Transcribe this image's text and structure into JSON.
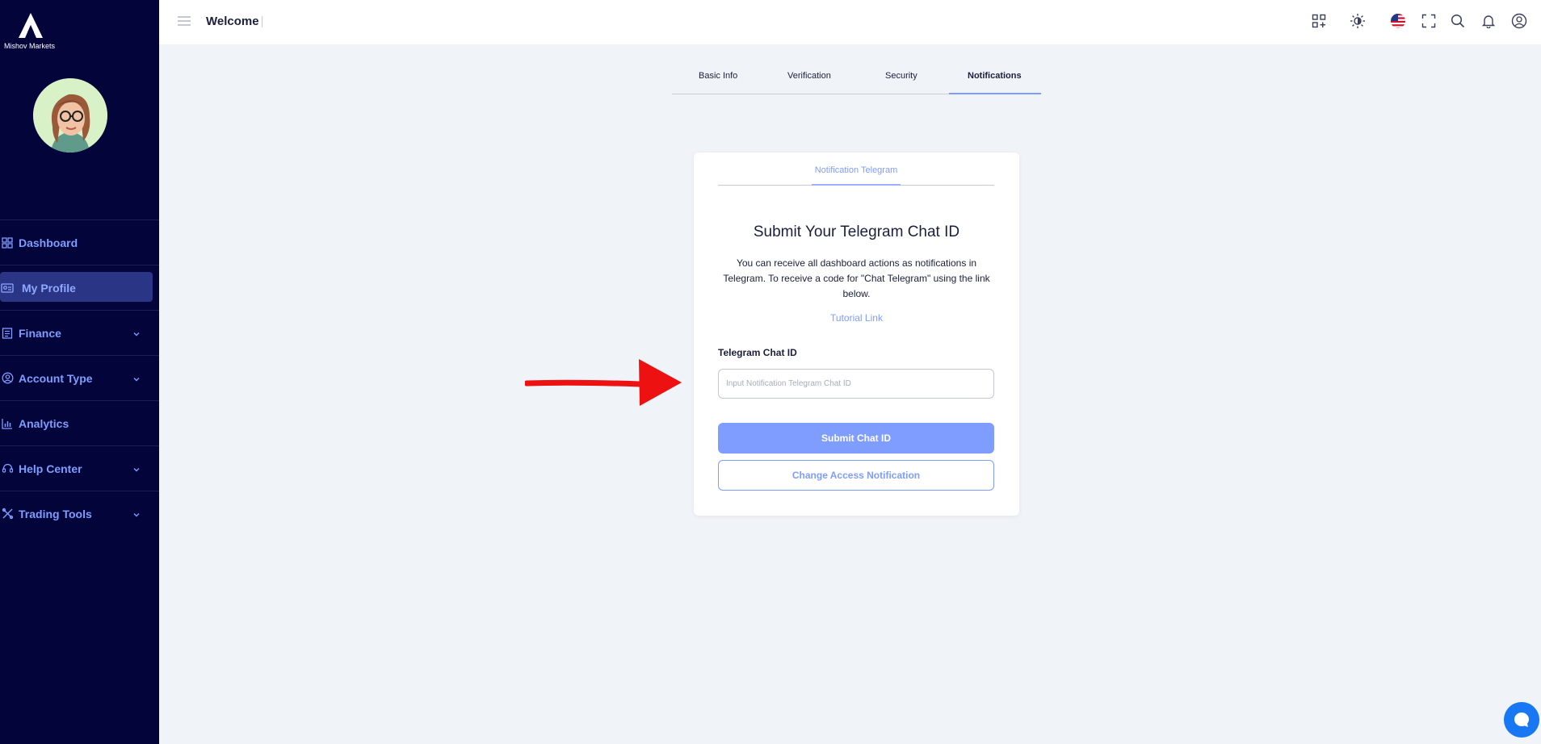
{
  "brand": {
    "name": "Mishov Markets"
  },
  "header": {
    "welcome": "Welcome"
  },
  "sidebar": {
    "items": [
      {
        "label": "Dashboard",
        "icon": "dashboard-icon",
        "has_chevron": false,
        "active": false
      },
      {
        "label": "My Profile",
        "icon": "profile-card-icon",
        "has_chevron": false,
        "active": true
      },
      {
        "label": "Finance",
        "icon": "finance-icon",
        "has_chevron": true,
        "active": false
      },
      {
        "label": "Account Type",
        "icon": "user-circle-icon",
        "has_chevron": true,
        "active": false
      },
      {
        "label": "Analytics",
        "icon": "analytics-icon",
        "has_chevron": false,
        "active": false
      },
      {
        "label": "Help Center",
        "icon": "headset-icon",
        "has_chevron": true,
        "active": false
      },
      {
        "label": "Trading Tools",
        "icon": "tools-icon",
        "has_chevron": true,
        "active": false
      }
    ]
  },
  "tabs": [
    {
      "label": "Basic Info",
      "active": false
    },
    {
      "label": "Verification",
      "active": false
    },
    {
      "label": "Security",
      "active": false
    },
    {
      "label": "Notifications",
      "active": true
    }
  ],
  "card": {
    "tab": "Notification Telegram",
    "title": "Submit Your Telegram Chat ID",
    "description": "You can receive all dashboard actions as notifications in Telegram. To receive a code for \"Chat Telegram\" using the link below.",
    "tutorial_link": "Tutorial Link",
    "field_label": "Telegram Chat ID",
    "field_placeholder": "Input Notification Telegram Chat ID",
    "field_value": "",
    "submit_label": "Submit Chat ID",
    "change_label": "Change Access Notification"
  },
  "colors": {
    "sidebar_bg": "#03053a",
    "accent": "#7f9cff",
    "page_bg": "#f0f3f8",
    "annotation_arrow": "#ee1111",
    "chat_bubble": "#1877f2"
  }
}
